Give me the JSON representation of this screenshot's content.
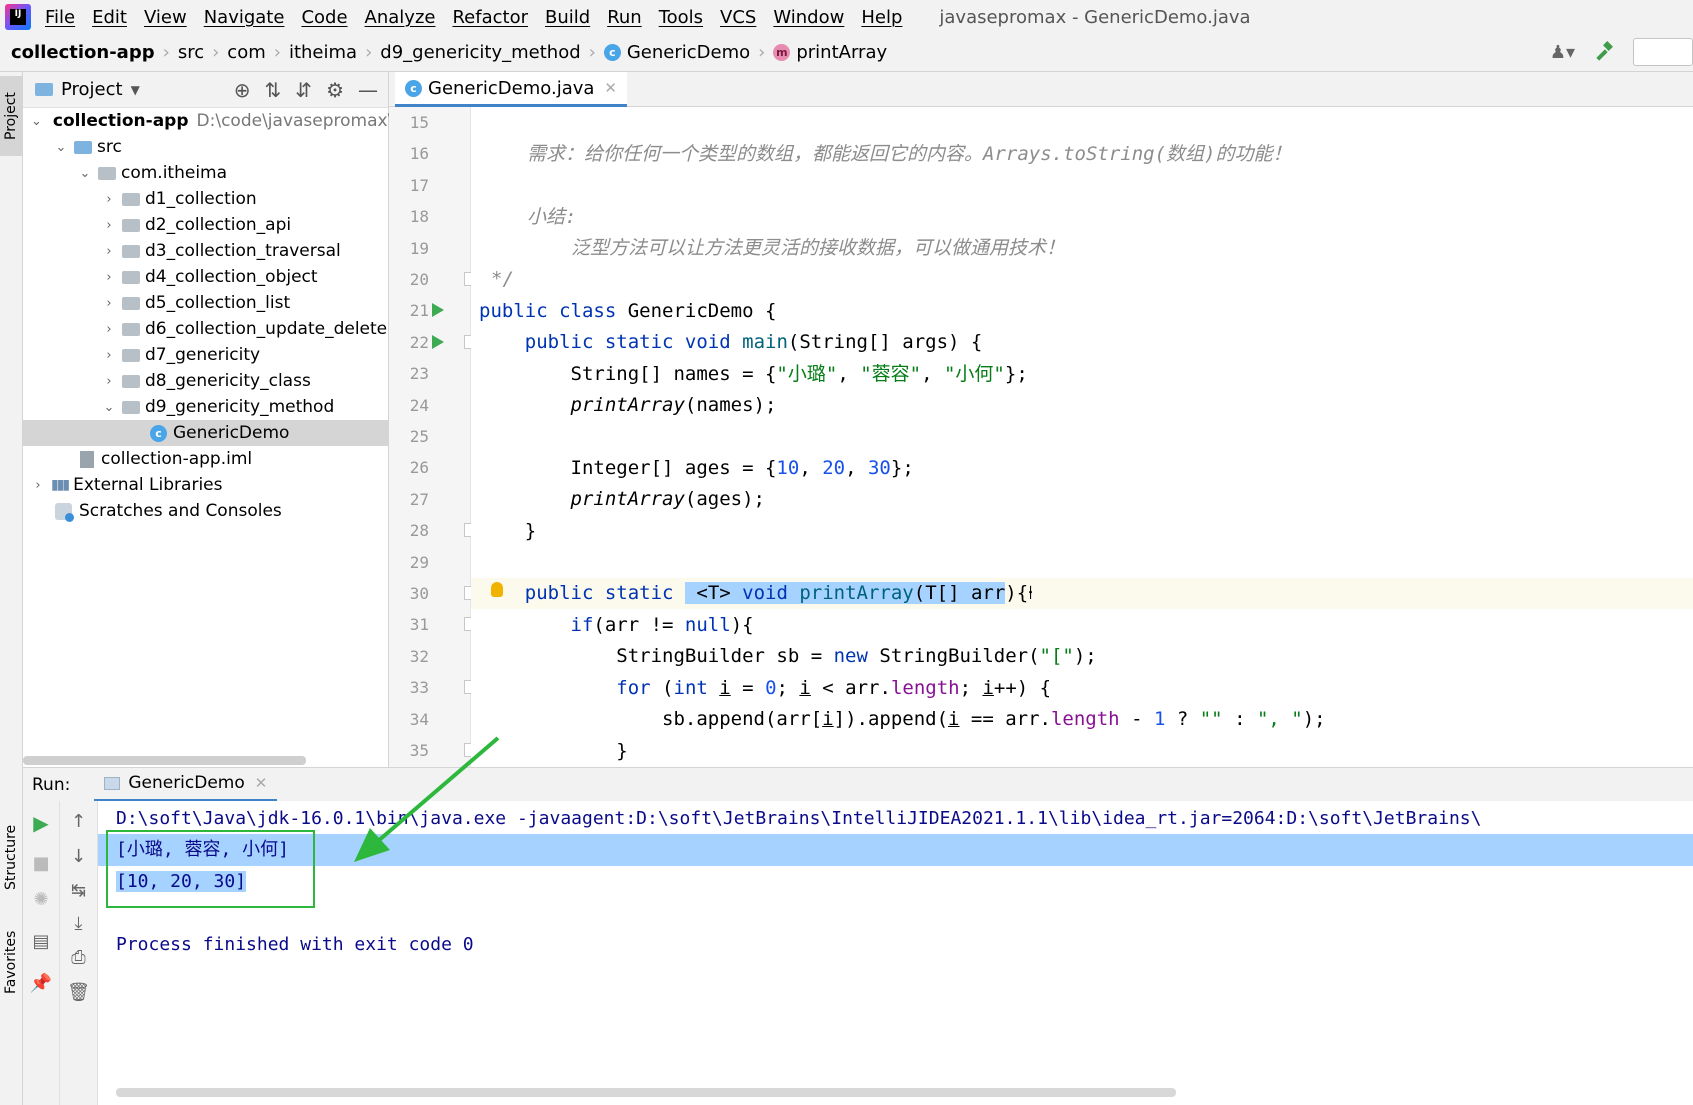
{
  "menubar": {
    "items": [
      "File",
      "Edit",
      "View",
      "Navigate",
      "Code",
      "Analyze",
      "Refactor",
      "Build",
      "Run",
      "Tools",
      "VCS",
      "Window",
      "Help"
    ],
    "title": "javasepromax - GenericDemo.java"
  },
  "breadcrumb": [
    "collection-app",
    "src",
    "com",
    "itheima",
    "d9_genericity_method",
    "GenericDemo",
    "printArray"
  ],
  "stripe": {
    "project": "Project",
    "structure": "Structure",
    "favorites": "Favorites"
  },
  "project_panel": {
    "title": "Project",
    "root_name": "collection-app",
    "root_path": "D:\\code\\javasepromax\\c",
    "items": [
      {
        "label": "src"
      },
      {
        "label": "com.itheima"
      },
      {
        "label": "d1_collection"
      },
      {
        "label": "d2_collection_api"
      },
      {
        "label": "d3_collection_traversal"
      },
      {
        "label": "d4_collection_object"
      },
      {
        "label": "d5_collection_list"
      },
      {
        "label": "d6_collection_update_delete"
      },
      {
        "label": "d7_genericity"
      },
      {
        "label": "d8_genericity_class"
      },
      {
        "label": "d9_genericity_method"
      },
      {
        "label": "GenericDemo"
      },
      {
        "label": "collection-app.iml"
      },
      {
        "label": "External Libraries"
      },
      {
        "label": "Scratches and Consoles"
      }
    ]
  },
  "editor": {
    "tab_label": "GenericDemo.java",
    "line_numbers": [
      "15",
      "16",
      "17",
      "18",
      "19",
      "20",
      "21",
      "22",
      "23",
      "24",
      "25",
      "26",
      "27",
      "28",
      "29",
      "30",
      "31",
      "32",
      "33",
      "34",
      "35"
    ],
    "comment_1": "需求：给你任何一个类型的数组，都能返回它的内容。Arrays.toString(数组)的功能！",
    "comment_2": "小结:",
    "comment_3": "泛型方法可以让方法更灵活的接收数据，可以做通用技术！",
    "comment_end": "*/",
    "string_1": "\"小璐\"",
    "string_2": "\"蓉容\"",
    "string_3": "\"小何\""
  },
  "run_panel": {
    "label": "Run:",
    "tab": "GenericDemo",
    "command": "D:\\soft\\Java\\jdk-16.0.1\\bin\\java.exe -javaagent:D:\\soft\\JetBrains\\IntelliJIDEA2021.1.1\\lib\\idea_rt.jar=2064:D:\\soft\\JetBrains\\",
    "output_1": "[小璐, 蓉容, 小何]",
    "output_2": "[10, 20, 30]",
    "exit_message": "Process finished with exit code 0"
  },
  "colors": {
    "keyword": "#0033b3",
    "string": "#067d17",
    "number": "#1750eb",
    "selection": "#a6d2ff",
    "annotation_green": "#2db83d"
  },
  "icons": [
    "intellij-logo",
    "run-icon",
    "stop-icon",
    "rerun-icon",
    "up-arrow-icon",
    "down-arrow-icon",
    "soft-wrap-icon",
    "print-icon",
    "trash-icon",
    "pin-icon",
    "settings-icon",
    "hammer-icon",
    "user-icon",
    "lightbulb-icon"
  ]
}
